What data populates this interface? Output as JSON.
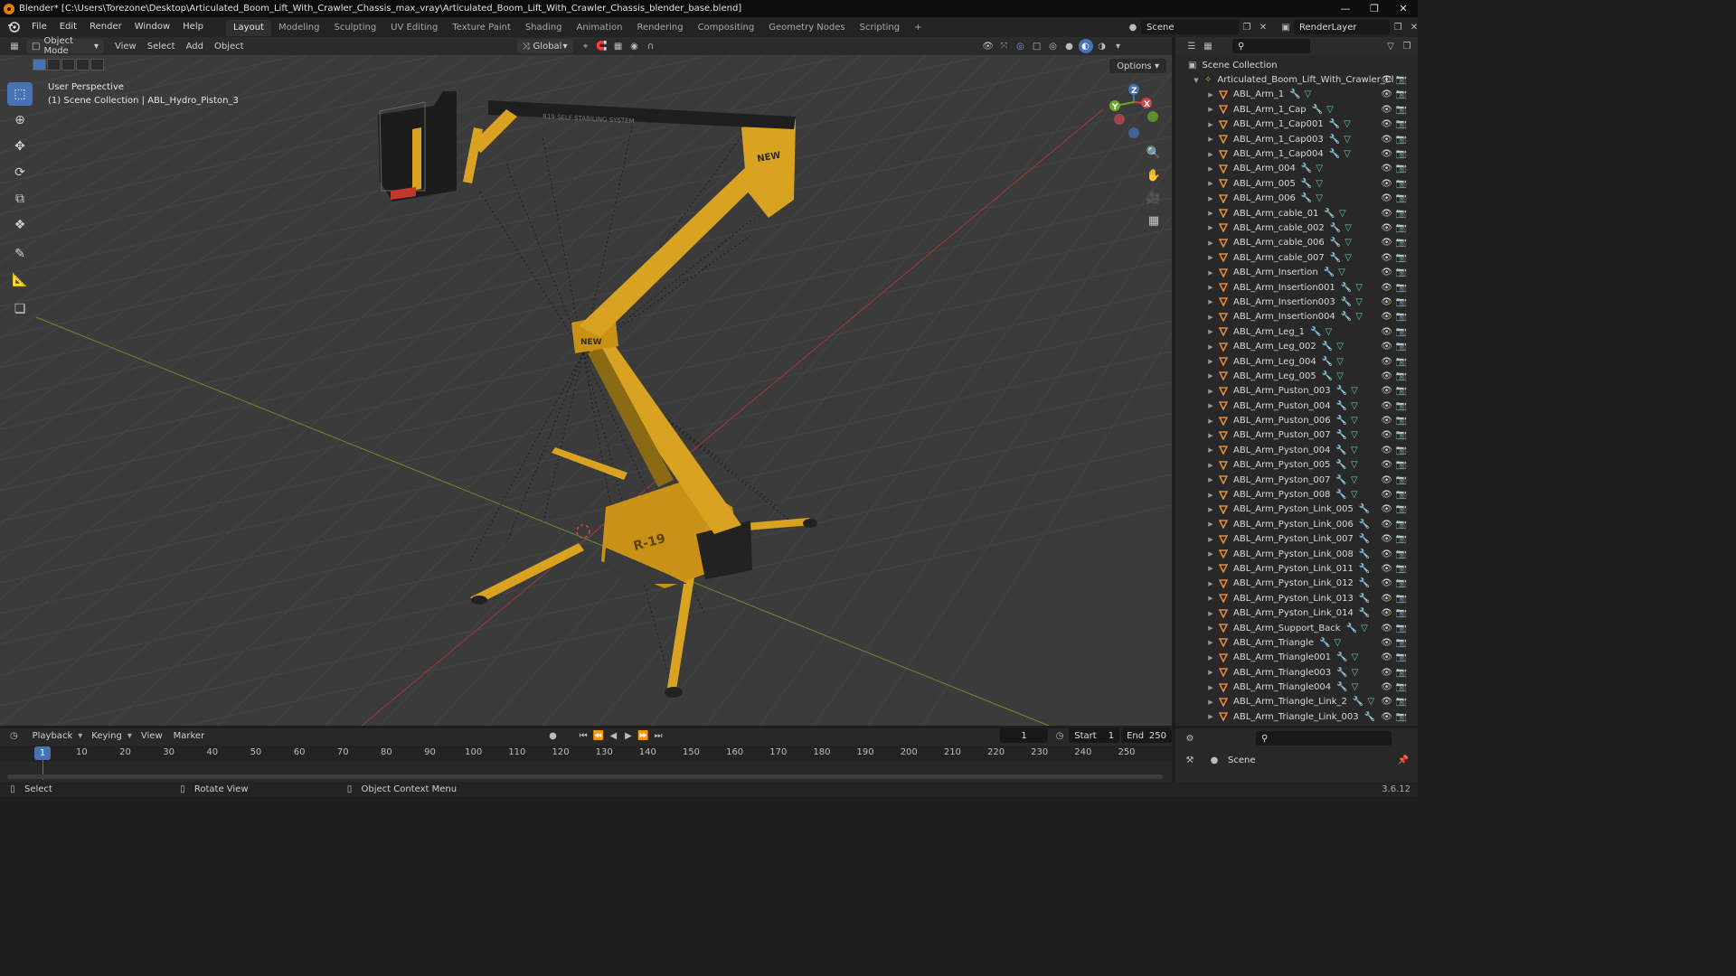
{
  "window": {
    "title": "Blender* [C:\\Users\\Torezone\\Desktop\\Articulated_Boom_Lift_With_Crawler_Chassis_max_vray\\Articulated_Boom_Lift_With_Crawler_Chassis_blender_base.blend]",
    "minimize_icon": "minimize-icon",
    "maximize_icon": "restore-icon",
    "close_icon": "close-icon"
  },
  "menu": {
    "items": [
      "File",
      "Edit",
      "Render",
      "Window",
      "Help"
    ],
    "workspaces": [
      "Layout",
      "Modeling",
      "Sculpting",
      "UV Editing",
      "Texture Paint",
      "Shading",
      "Animation",
      "Rendering",
      "Compositing",
      "Geometry Nodes",
      "Scripting"
    ],
    "active_workspace": "Layout",
    "add_workspace": "+",
    "scene": "Scene",
    "view_layer": "RenderLayer"
  },
  "viewport_header": {
    "mode": "Object Mode",
    "menus": [
      "View",
      "Select",
      "Add",
      "Object"
    ],
    "transform_orientation": "Global",
    "options": "Options"
  },
  "viewport": {
    "perspective": "User Perspective",
    "context": "(1) Scene Collection | ABL_Hydro_Piston_3",
    "gizmo": {
      "x": "X",
      "y": "Y",
      "z": "Z"
    },
    "colors": {
      "background": "#3b3b3b",
      "grid": "#444444",
      "x_axis": "#9c3b3b",
      "y_axis": "#6a8f2a",
      "machine": "#d9a321",
      "machine_dark": "#8a6a12"
    }
  },
  "tools": [
    "select-box-icon",
    "cursor-icon",
    "move-icon",
    "rotate-icon",
    "scale-icon",
    "transform-icon",
    "annotate-icon",
    "measure-icon",
    "add-cube-icon"
  ],
  "nav_tools": [
    "zoom-icon",
    "pan-hand-icon",
    "camera-icon",
    "ortho-grid-icon"
  ],
  "outliner": {
    "root": "Scene Collection",
    "collection": "Articulated_Boom_Lift_With_Crawler_Cl",
    "objects": [
      {
        "name": "ABL_Arm_1",
        "mod": true,
        "mesh": true
      },
      {
        "name": "ABL_Arm_1_Cap",
        "mod": true,
        "mesh": true
      },
      {
        "name": "ABL_Arm_1_Cap001",
        "mod": true,
        "mesh": true
      },
      {
        "name": "ABL_Arm_1_Cap003",
        "mod": true,
        "mesh": true
      },
      {
        "name": "ABL_Arm_1_Cap004",
        "mod": true,
        "mesh": true
      },
      {
        "name": "ABL_Arm_004",
        "mod": true,
        "mesh": true
      },
      {
        "name": "ABL_Arm_005",
        "mod": true,
        "mesh": true
      },
      {
        "name": "ABL_Arm_006",
        "mod": true,
        "mesh": true
      },
      {
        "name": "ABL_Arm_cable_01",
        "mod": true,
        "mesh": true
      },
      {
        "name": "ABL_Arm_cable_002",
        "mod": true,
        "mesh": true
      },
      {
        "name": "ABL_Arm_cable_006",
        "mod": true,
        "mesh": true
      },
      {
        "name": "ABL_Arm_cable_007",
        "mod": true,
        "mesh": true
      },
      {
        "name": "ABL_Arm_Insertion",
        "mod": true,
        "mesh": true
      },
      {
        "name": "ABL_Arm_Insertion001",
        "mod": true,
        "mesh": true
      },
      {
        "name": "ABL_Arm_Insertion003",
        "mod": true,
        "mesh": true
      },
      {
        "name": "ABL_Arm_Insertion004",
        "mod": true,
        "mesh": true
      },
      {
        "name": "ABL_Arm_Leg_1",
        "mod": true,
        "mesh": true
      },
      {
        "name": "ABL_Arm_Leg_002",
        "mod": true,
        "mesh": true
      },
      {
        "name": "ABL_Arm_Leg_004",
        "mod": true,
        "mesh": true
      },
      {
        "name": "ABL_Arm_Leg_005",
        "mod": true,
        "mesh": true
      },
      {
        "name": "ABL_Arm_Puston_003",
        "mod": true,
        "mesh": true
      },
      {
        "name": "ABL_Arm_Puston_004",
        "mod": true,
        "mesh": true
      },
      {
        "name": "ABL_Arm_Puston_006",
        "mod": true,
        "mesh": true
      },
      {
        "name": "ABL_Arm_Puston_007",
        "mod": true,
        "mesh": true
      },
      {
        "name": "ABL_Arm_Pyston_004",
        "mod": true,
        "mesh": true
      },
      {
        "name": "ABL_Arm_Pyston_005",
        "mod": true,
        "mesh": true
      },
      {
        "name": "ABL_Arm_Pyston_007",
        "mod": true,
        "mesh": true
      },
      {
        "name": "ABL_Arm_Pyston_008",
        "mod": true,
        "mesh": true
      },
      {
        "name": "ABL_Arm_Pyston_Link_005",
        "mod": true,
        "mesh": false
      },
      {
        "name": "ABL_Arm_Pyston_Link_006",
        "mod": true,
        "mesh": false
      },
      {
        "name": "ABL_Arm_Pyston_Link_007",
        "mod": true,
        "mesh": false
      },
      {
        "name": "ABL_Arm_Pyston_Link_008",
        "mod": true,
        "mesh": false
      },
      {
        "name": "ABL_Arm_Pyston_Link_011",
        "mod": true,
        "mesh": false
      },
      {
        "name": "ABL_Arm_Pyston_Link_012",
        "mod": true,
        "mesh": false
      },
      {
        "name": "ABL_Arm_Pyston_Link_013",
        "mod": true,
        "mesh": false
      },
      {
        "name": "ABL_Arm_Pyston_Link_014",
        "mod": true,
        "mesh": false
      },
      {
        "name": "ABL_Arm_Support_Back",
        "mod": true,
        "mesh": true
      },
      {
        "name": "ABL_Arm_Triangle",
        "mod": true,
        "mesh": true
      },
      {
        "name": "ABL_Arm_Triangle001",
        "mod": true,
        "mesh": true
      },
      {
        "name": "ABL_Arm_Triangle003",
        "mod": true,
        "mesh": true
      },
      {
        "name": "ABL_Arm_Triangle004",
        "mod": true,
        "mesh": true
      },
      {
        "name": "ABL_Arm_Triangle_Link_2",
        "mod": true,
        "mesh": true
      },
      {
        "name": "ABL_Arm_Triangle_Link_003",
        "mod": true,
        "mesh": false
      }
    ]
  },
  "properties": {
    "scene": "Scene"
  },
  "timeline": {
    "menus": [
      "Playback",
      "Keying",
      "View",
      "Marker"
    ],
    "current_frame": "1",
    "start_label": "Start",
    "start": "1",
    "end_label": "End",
    "end": "250",
    "ticks": [
      "1",
      "10",
      "20",
      "30",
      "40",
      "50",
      "60",
      "70",
      "80",
      "90",
      "100",
      "110",
      "120",
      "130",
      "140",
      "150",
      "160",
      "170",
      "180",
      "190",
      "200",
      "210",
      "220",
      "230",
      "240",
      "250"
    ]
  },
  "statusbar": {
    "select": "Select",
    "rotate": "Rotate View",
    "context_menu": "Object Context Menu",
    "version": "3.6.12"
  }
}
